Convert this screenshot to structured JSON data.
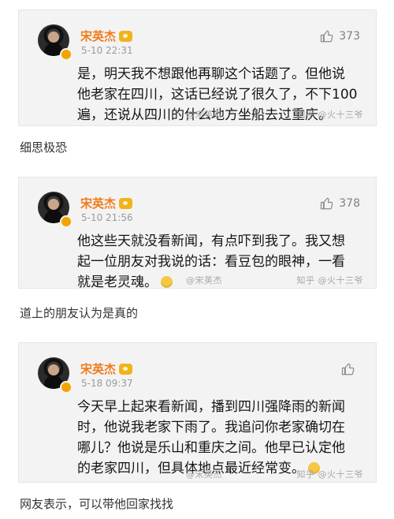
{
  "posts": [
    {
      "author": "宋英杰",
      "time": "5-10 22:31",
      "likes": "373",
      "lines": [
        "是，明天我不想跟他再聊这个话题了。但他说",
        "他老家在四川，这话已经说了很久了，不下100",
        "遍，还说从四川的什么地方坐船去过重庆。"
      ],
      "watermark_weibo": "@宋英杰",
      "watermark_zhihu": "知乎 @火十三爷",
      "emoji": false
    },
    {
      "author": "宋英杰",
      "time": "5-10 21:56",
      "likes": "378",
      "lines": [
        "他这些天就没看新闻，有点吓到我了。我又想",
        "起一位朋友对我说的话：看豆包的眼神，一看",
        "就是老灵魂。"
      ],
      "watermark_weibo": "@宋英杰",
      "watermark_zhihu": "知乎 @火十三爷",
      "emoji": true
    },
    {
      "author": "宋英杰",
      "time": "5-18 09:37",
      "likes": "",
      "lines": [
        "今天早上起来看新闻，播到四川强降雨的新闻",
        "时，他说我老家下雨了。我追问你老家确切在",
        "哪儿？他说是乐山和重庆之间。他早已认定他",
        "的老家四川，但具体地点最近经常变。"
      ],
      "watermark_weibo": "@宋英杰",
      "watermark_zhihu": "知乎 @火十三爷",
      "emoji": true
    }
  ],
  "captions": [
    "细思极恐",
    "道上的朋友认为是真的",
    "网友表示，可以带他回家找找"
  ],
  "colors": {
    "author": "#f07b1a",
    "card_bg": "#f3f3f3",
    "meta": "#9a9a9a"
  },
  "icons": {
    "like": "thumbs-up-icon",
    "vip": "vip-badge-icon",
    "emoji": "emoji-icon"
  }
}
